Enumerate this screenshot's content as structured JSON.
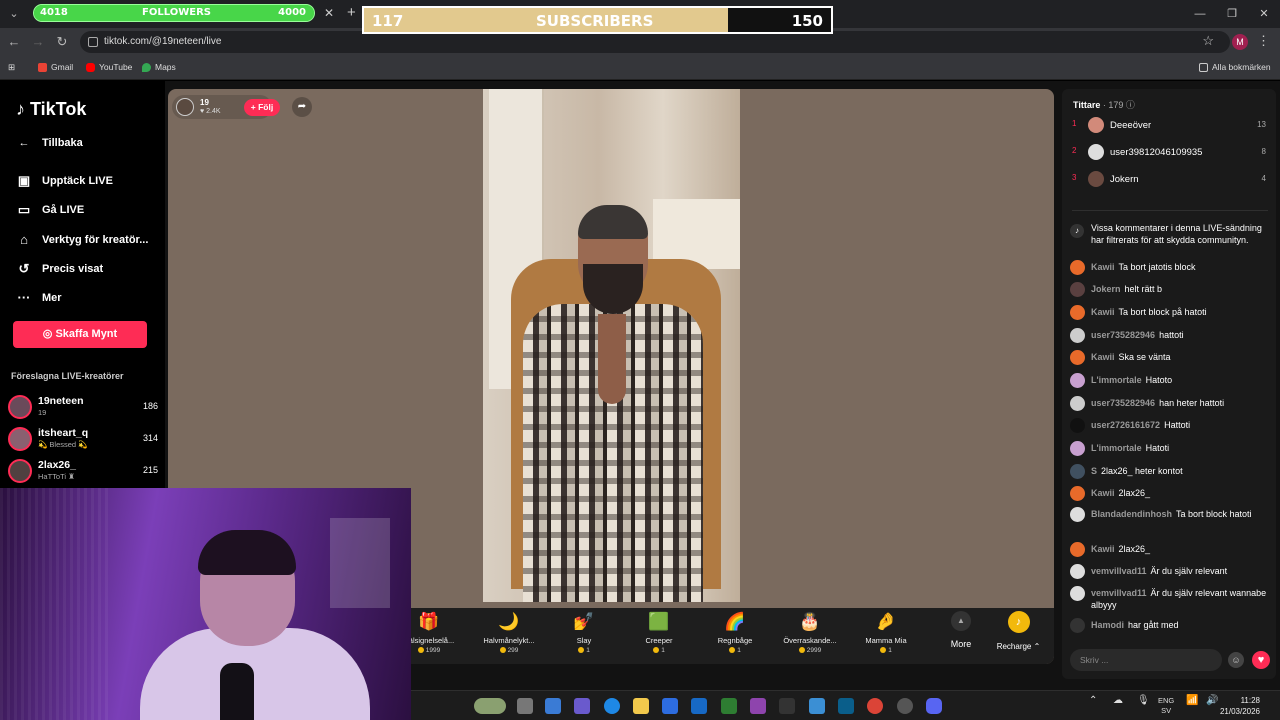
{
  "overlay": {
    "followers": {
      "current": "4018",
      "label": "FOLLOWERS",
      "goal": "4000",
      "progress": 1.0
    },
    "subscribers": {
      "current": "117",
      "label": "SUBSCRIBERS",
      "goal": "150",
      "progress": 0.78
    }
  },
  "browser": {
    "url": "tiktok.com/@19neteen/live",
    "bookmarks": [
      "Gmail",
      "YouTube",
      "Maps"
    ],
    "all_bookmarks": "Alla bokmärken",
    "profile_initial": "M"
  },
  "sidebar": {
    "logo": "TikTok",
    "back": "Tillbaka",
    "items": [
      {
        "label": "Upptäck LIVE",
        "icon": "calendar-icon"
      },
      {
        "label": "Gå LIVE",
        "icon": "camera-icon"
      },
      {
        "label": "Verktyg för kreatör...",
        "icon": "home-tools-icon"
      },
      {
        "label": "Precis visat",
        "icon": "history-icon"
      },
      {
        "label": "Mer",
        "icon": "more-icon"
      }
    ],
    "coins_button": "Skaffa Mynt",
    "suggested_title": "Föreslagna LIVE-kreatörer",
    "creators": [
      {
        "name": "19neteen",
        "sub": "19",
        "count": "186"
      },
      {
        "name": "itsheart_q",
        "sub": "💫 Blessed 💫",
        "count": "314"
      },
      {
        "name": "2lax26_",
        "sub": "HaTToTi ♜",
        "count": "215"
      }
    ]
  },
  "stream": {
    "host_name": "19",
    "host_likes": "2.4K",
    "follow": "+ Följ"
  },
  "gifts": [
    {
      "name": "Välsignelselå...",
      "price": "1999",
      "icon": "🎁"
    },
    {
      "name": "Halvmånelykt...",
      "price": "299",
      "icon": "🌙"
    },
    {
      "name": "Slay",
      "price": "1",
      "icon": "💅"
    },
    {
      "name": "Creeper",
      "price": "1",
      "icon": "🟩"
    },
    {
      "name": "Regnbåge",
      "price": "1",
      "icon": "🌈"
    },
    {
      "name": "Överraskande...",
      "price": "2999",
      "icon": "🎂"
    },
    {
      "name": "Mamma Mia",
      "price": "1",
      "icon": "🤌"
    }
  ],
  "gift_more": "More",
  "recharge": "Recharge",
  "chat": {
    "viewers_label": "Tittare",
    "viewers_count": "· 179",
    "top": [
      {
        "rank": "1",
        "name": "Deeeöver",
        "score": "13"
      },
      {
        "rank": "2",
        "name": "user39812046109935",
        "score": "8"
      },
      {
        "rank": "3",
        "name": "Jokern",
        "score": "4"
      }
    ],
    "system": "Vissa kommentarer i denna LIVE-sändning har filtrerats för att skydda communityn.",
    "messages": [
      {
        "user": "Kawii",
        "text": "Ta bort jatotis block",
        "color": "#e86a2a"
      },
      {
        "user": "Jokern",
        "text": "helt rätt b",
        "color": "#5a4040"
      },
      {
        "user": "Kawii",
        "text": "Ta bort block på hatoti",
        "color": "#e86a2a"
      },
      {
        "user": "user735282946",
        "text": "hattoti",
        "color": "#cccccc"
      },
      {
        "user": "Kawii",
        "text": "Ska se vänta",
        "color": "#e86a2a"
      },
      {
        "user": "L'immortale",
        "text": "Hatoto",
        "color": "#c8a0d0"
      },
      {
        "user": "user735282946",
        "text": "han heter hattoti",
        "color": "#cccccc"
      },
      {
        "user": "user2726161672",
        "text": "Hattoti",
        "color": "#111111"
      },
      {
        "user": "L'immortale",
        "text": "Hatoti",
        "color": "#c8a0d0"
      },
      {
        "user": "S",
        "text": "2lax26_ heter kontot",
        "color": "#405060"
      },
      {
        "user": "Kawii",
        "text": "2lax26_",
        "color": "#e86a2a"
      },
      {
        "user": "Blandadendinhosh",
        "text": "Ta bort block hatoti",
        "color": "#dddddd"
      },
      {
        "user": "Kawii",
        "text": "2lax26_",
        "color": "#e86a2a"
      },
      {
        "user": "vemvillvad11",
        "text": "Är du själv relevant",
        "color": "#dddddd"
      },
      {
        "user": "vemvillvad11",
        "text": "Är du själv relevant wannabe albyyy",
        "color": "#dddddd"
      },
      {
        "user": "Hamodi",
        "text": "har gått med",
        "color": "#333333"
      }
    ],
    "input_placeholder": "Skriv ..."
  },
  "taskbar": {
    "lang": "ENG",
    "region": "SV",
    "time": "11:28",
    "date": "21/03/2026"
  }
}
